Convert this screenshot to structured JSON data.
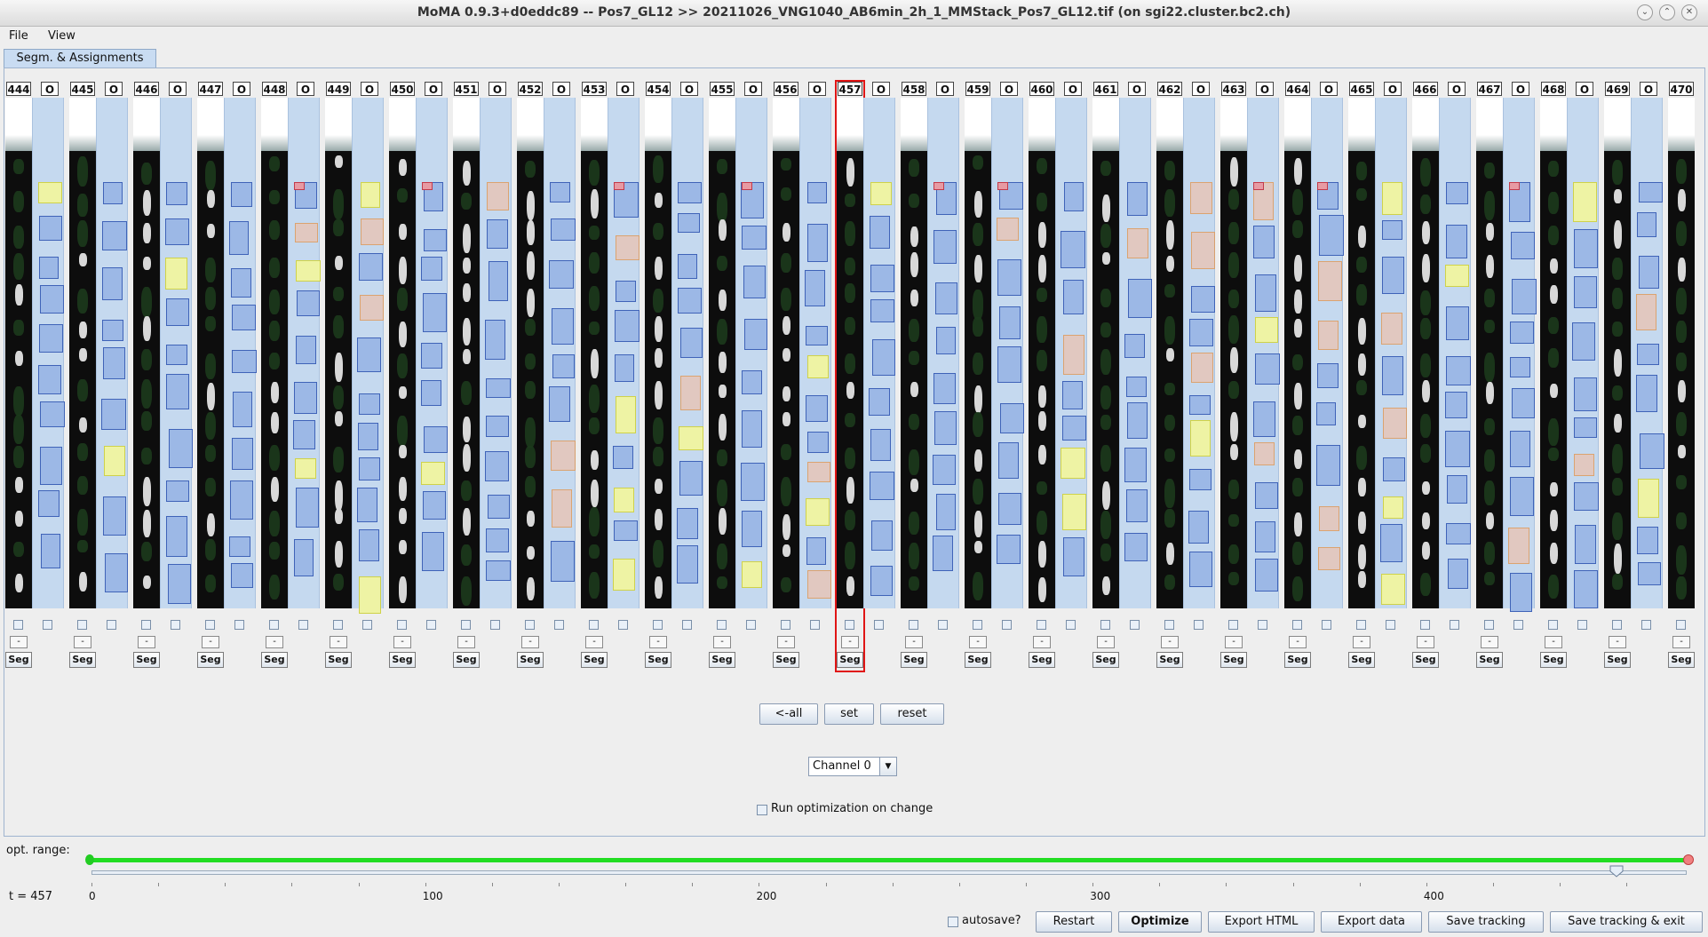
{
  "window": {
    "title": "MoMA 0.9.3+d0eddc89 -- Pos7_GL12 >> 20211026_VNG1040_AB6min_2h_1_MMStack_Pos7_GL12.tif (on sgi22.cluster.bc2.ch)",
    "controls": [
      "chevron-down",
      "chevron-up",
      "close"
    ]
  },
  "menu": {
    "items": [
      "File",
      "View"
    ]
  },
  "tab": {
    "label": "Segm. & Assignments"
  },
  "timepoints": [
    "444",
    "445",
    "446",
    "447",
    "448",
    "449",
    "450",
    "451",
    "452",
    "453",
    "454",
    "455",
    "456",
    "457",
    "458",
    "459",
    "460",
    "461",
    "462",
    "463",
    "464",
    "465",
    "466",
    "467",
    "468",
    "469",
    "470"
  ],
  "selected_timepoint": "457",
  "assignment_header": "O",
  "column_labels": {
    "dash": "-",
    "seg": "Seg"
  },
  "buttons": {
    "all_left": "<-all",
    "set": "set",
    "reset": "reset"
  },
  "channel": {
    "selected": "Channel 0"
  },
  "run_optimization": {
    "label": "Run optimization on change",
    "checked": false
  },
  "opt_range": {
    "label": "opt. range:"
  },
  "slider": {
    "t_label": "t = 457",
    "value": 457,
    "min": 0,
    "max": 478,
    "ticks": [
      "0",
      "100",
      "200",
      "300",
      "400"
    ]
  },
  "bottom": {
    "autosave_label": "autosave?",
    "autosave_checked": false,
    "restart": "Restart",
    "optimize": "Optimize",
    "export_html": "Export HTML",
    "export_data": "Export data",
    "save_tracking": "Save tracking",
    "save_exit": "Save tracking & exit"
  },
  "colors": {
    "selection": "#e01515",
    "range_bar": "#22dd22",
    "assignment_bg": "#c5d9ef",
    "segment_fill": "#9cb8e6"
  }
}
